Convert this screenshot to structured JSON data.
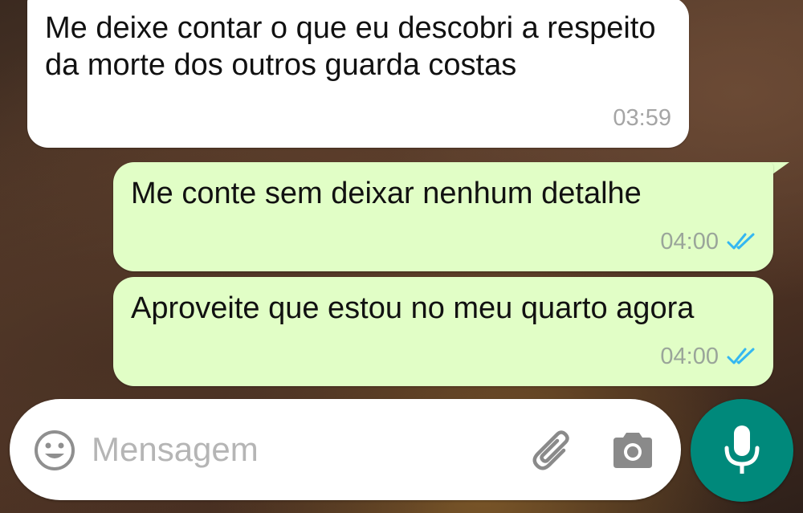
{
  "messages": [
    {
      "direction": "incoming",
      "text": "Me deixe contar o que eu descobri a respeito da morte dos outros guarda costas",
      "time": "03:59"
    },
    {
      "direction": "outgoing",
      "text": "Me conte sem deixar nenhum detalhe",
      "time": "04:00",
      "status": "read"
    },
    {
      "direction": "outgoing",
      "text": "Aproveite que estou no meu quarto agora",
      "time": "04:00",
      "status": "read"
    }
  ],
  "composer": {
    "placeholder": "Mensagem"
  },
  "icons": {
    "emoji": "emoji-icon",
    "attach": "paperclip-icon",
    "camera": "camera-icon",
    "mic": "microphone-icon",
    "read_receipt": "double-check-icon"
  },
  "colors": {
    "incoming_bubble": "#ffffff",
    "outgoing_bubble": "#e1fec6",
    "read_tick": "#34b7f1",
    "mic_button": "#00897b",
    "placeholder": "#b5b5b5"
  }
}
